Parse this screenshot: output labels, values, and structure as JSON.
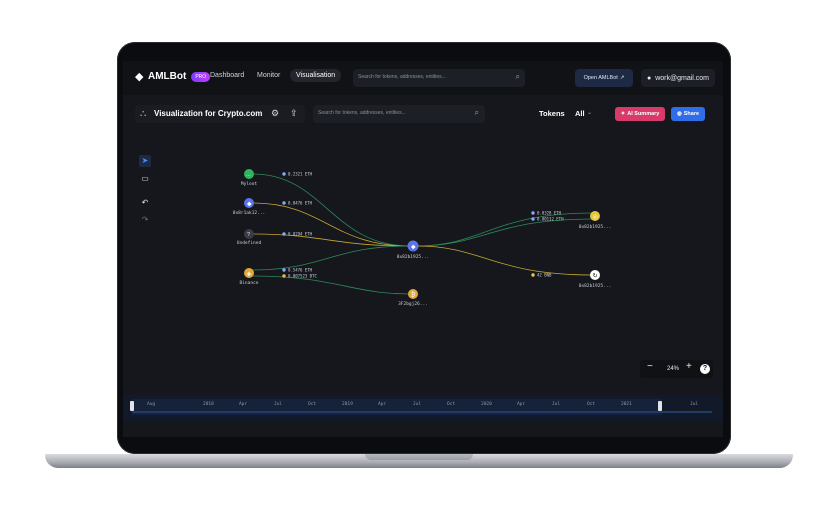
{
  "app": {
    "brand": "AMLBot",
    "pro_badge": "PRO",
    "nav": [
      "Dashboard",
      "Monitor",
      "Visualisation"
    ],
    "search_placeholder": "Search for tokens, addresses, entities...",
    "open_button": "Open AMLBot",
    "account_email": "work@gmail.com"
  },
  "toolbar": {
    "title": "Visualization for Crypto.com",
    "search_placeholder": "Search for tokens, addresses, entities...",
    "tokens_label": "Tokens",
    "tokens_value": "All",
    "ai_summary": "AI Summary",
    "share": "Share"
  },
  "graph": {
    "nodes": [
      {
        "id": "n1",
        "label": "Myloot",
        "color": "#2fb35c",
        "icon": "dots-icon"
      },
      {
        "id": "n2",
        "label": "0x8r1ak12...",
        "color": "#5b74e8",
        "icon": "ethereum-icon"
      },
      {
        "id": "n3",
        "label": "Undefined",
        "color": "#3a3d44",
        "icon": "question-icon"
      },
      {
        "id": "n4",
        "label": "Binance",
        "color": "#e2a93a",
        "icon": "binance-icon"
      },
      {
        "id": "n5",
        "label": "0x82b1925...",
        "color": "#5b74e8",
        "icon": "ethereum-icon"
      },
      {
        "id": "n6",
        "label": "3F2bgj26...",
        "color": "#e2a93a",
        "icon": "bitcoin-icon"
      },
      {
        "id": "n7",
        "label": "0x82b1925...",
        "color": "#e2c53a",
        "icon": "coin-icon"
      },
      {
        "id": "n8",
        "label": "0x82b1925...",
        "color": "#ffffff",
        "icon": "loop-icon"
      }
    ],
    "amounts": [
      {
        "text": "0.2321 ETH",
        "dot": "#8aa4ff"
      },
      {
        "text": "0.0476 ETH",
        "dot": "#8aa4ff"
      },
      {
        "text": "0.0294 ETH",
        "dot": "#8aa4ff"
      },
      {
        "text": "0.5476 ETH",
        "dot": "#8aa4ff"
      },
      {
        "text": "0.007523 BTC",
        "dot": "#f0b640"
      },
      {
        "text": "0.0328 ETH",
        "dot": "#8aa4ff"
      },
      {
        "text": "0.00132 ETH",
        "dot": "#8aa4ff"
      },
      {
        "text": "42 BNB",
        "dot": "#f0c640"
      }
    ],
    "edge_colors": {
      "green": "#2f8a5a",
      "yellow": "#c8a830"
    }
  },
  "zoom": {
    "minus": "−",
    "value": "24%",
    "plus": "+",
    "help": "?"
  },
  "timeline": {
    "ticks": [
      "Aug",
      "2018",
      "Apr",
      "Jul",
      "Oct",
      "2019",
      "Apr",
      "Jul",
      "Oct",
      "2020",
      "Apr",
      "Jul",
      "Oct",
      "2021",
      "Jul"
    ]
  }
}
